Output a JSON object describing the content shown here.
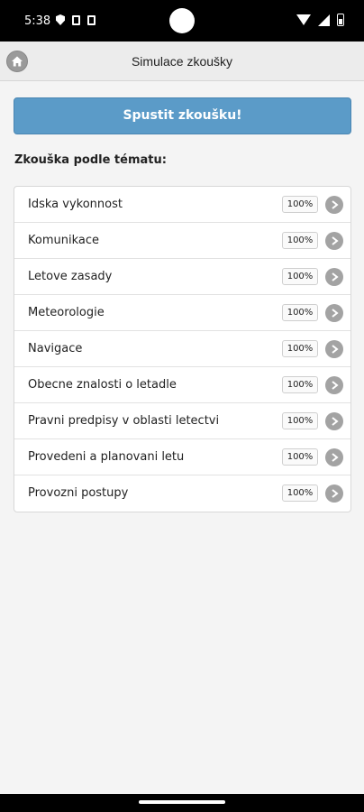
{
  "status_bar": {
    "time": "5:38"
  },
  "header": {
    "title": "Simulace zkoušky"
  },
  "start_button": {
    "label": "Spustit zkoušku!"
  },
  "section_label": "Zkouška podle tématu:",
  "topics": [
    {
      "label": "Idska vykonnost",
      "percent": "100%"
    },
    {
      "label": "Komunikace",
      "percent": "100%"
    },
    {
      "label": "Letove zasady",
      "percent": "100%"
    },
    {
      "label": "Meteorologie",
      "percent": "100%"
    },
    {
      "label": "Navigace",
      "percent": "100%"
    },
    {
      "label": "Obecne znalosti o letadle",
      "percent": "100%"
    },
    {
      "label": "Pravni predpisy v oblasti letectvi",
      "percent": "100%"
    },
    {
      "label": "Provedeni a planovani letu",
      "percent": "100%"
    },
    {
      "label": "Provozni postupy",
      "percent": "100%"
    }
  ],
  "icons": {
    "home": "home-icon",
    "arrow": "chevron-right-icon"
  },
  "colors": {
    "accent": "#5b9bc8",
    "arrow": "#a3a3a3"
  }
}
